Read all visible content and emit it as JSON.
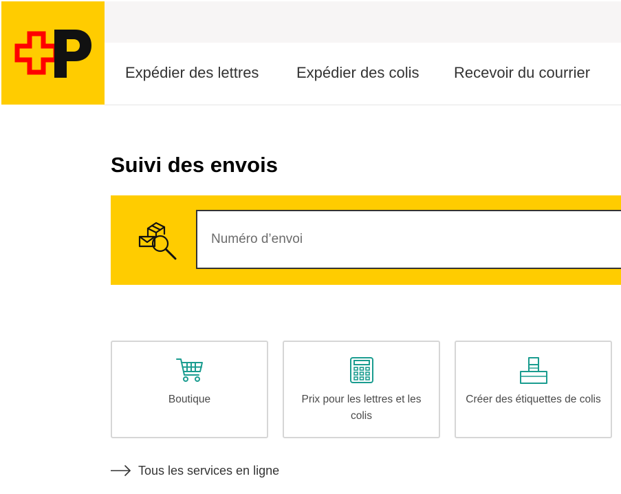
{
  "nav": {
    "items": [
      {
        "label": "Expédier des lettres"
      },
      {
        "label": "Expédier des colis"
      },
      {
        "label": "Recevoir du courrier"
      }
    ]
  },
  "tracking": {
    "title": "Suivi des envois",
    "placeholder": "Numéro d’envoi",
    "icon": "parcel-search-icon"
  },
  "tiles": [
    {
      "label": "Boutique",
      "icon": "shopping-cart-icon"
    },
    {
      "label": "Prix pour les lettres et les colis",
      "icon": "calculator-icon"
    },
    {
      "label": "Créer des étiquettes de colis",
      "icon": "stacked-parcels-icon"
    }
  ],
  "all_services": {
    "label": "Tous les services en ligne",
    "icon": "arrow-right-icon"
  },
  "colors": {
    "brand_yellow": "#ffcc00",
    "brand_red": "#ff0000",
    "icon_teal": "#1a9c8f",
    "text": "#333333"
  }
}
